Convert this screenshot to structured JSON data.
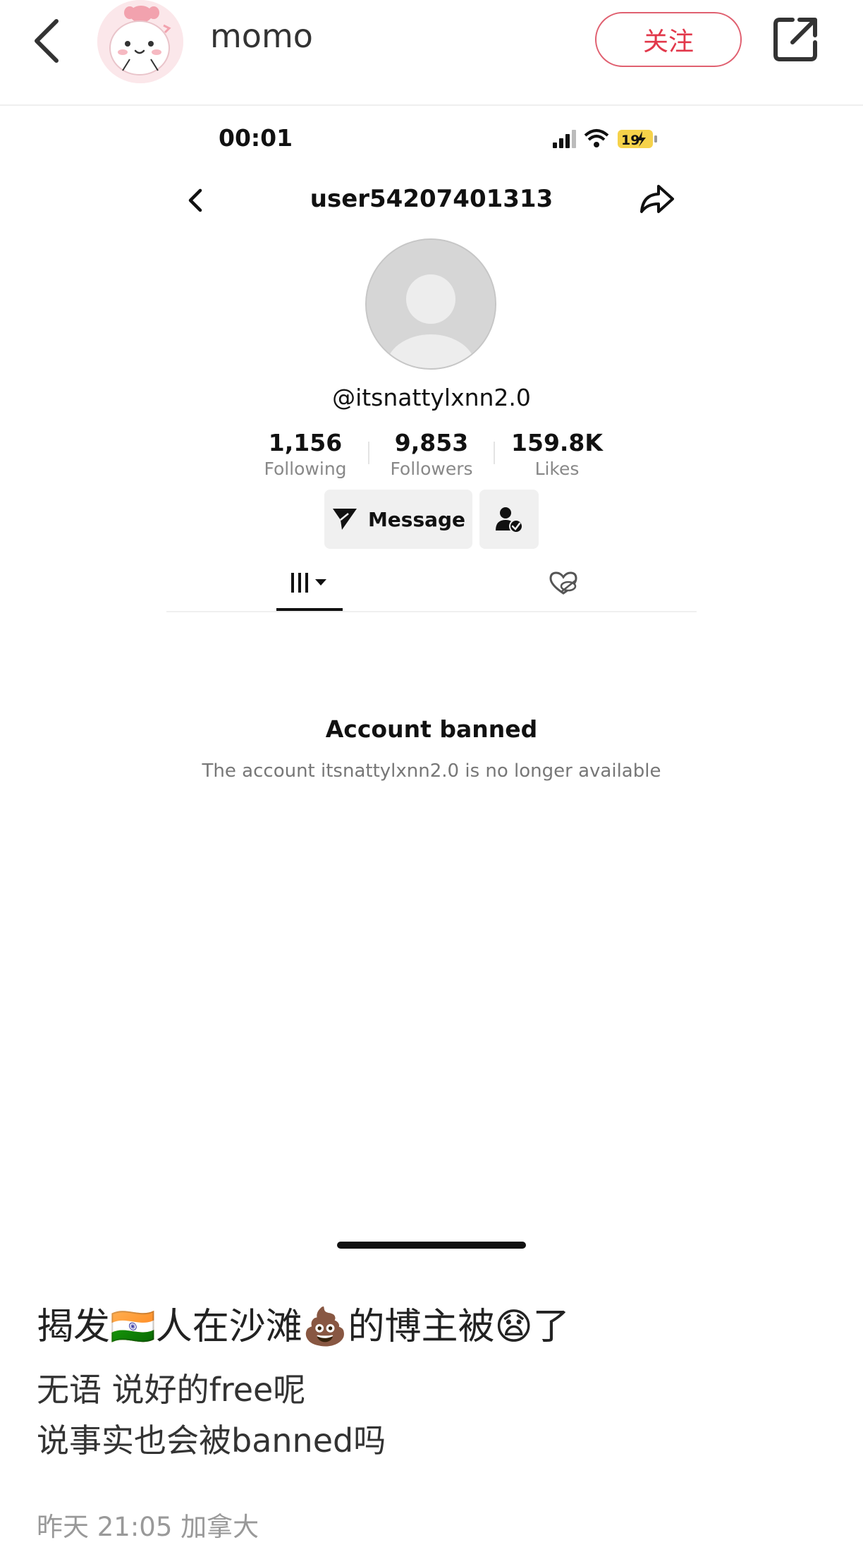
{
  "topbar": {
    "username": "momo",
    "follow_label": "关注"
  },
  "phone": {
    "status_time": "00:01",
    "battery": "19",
    "profile_title": "user54207401313",
    "handle": "@itsnattylxnn2.0",
    "stats": [
      {
        "value": "1,156",
        "label": "Following"
      },
      {
        "value": "9,853",
        "label": "Followers"
      },
      {
        "value": "159.8K",
        "label": "Likes"
      }
    ],
    "message_label": "Message",
    "banned_title": "Account banned",
    "banned_desc": "The account itsnattylxnn2.0 is no longer available"
  },
  "post": {
    "title": "揭发🇮🇳人在沙滩💩的博主被😧了",
    "body": "无语 说好的free呢\n说事实也会被banned吗",
    "meta": "昨天 21:05 加拿大"
  },
  "colors": {
    "accent": "#e2384b",
    "battery": "#f6d24a"
  }
}
